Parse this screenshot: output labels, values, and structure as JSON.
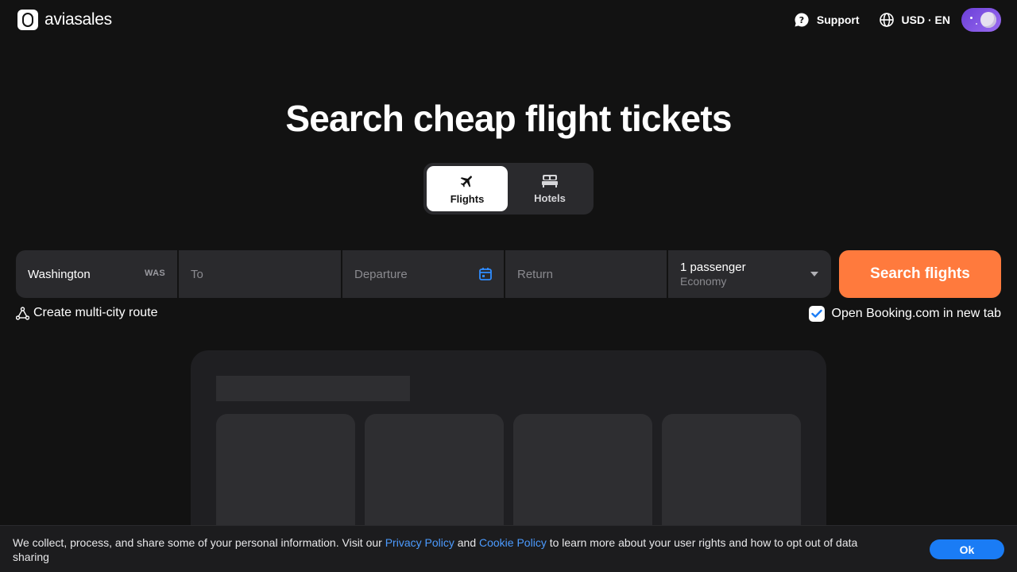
{
  "header": {
    "logo_text": "aviasales",
    "support_label": "Support",
    "currency_lang_label": "USD · EN"
  },
  "hero": {
    "title": "Search cheap flight tickets"
  },
  "tabs": [
    {
      "label": "Flights",
      "icon": "plane-icon",
      "active": true
    },
    {
      "label": "Hotels",
      "icon": "bed-icon",
      "active": false
    }
  ],
  "search": {
    "origin_value": "Washington",
    "origin_code": "WAS",
    "destination_placeholder": "To",
    "departure_placeholder": "Departure",
    "return_placeholder": "Return",
    "passengers": "1 passenger",
    "cabin_class": "Economy",
    "button_label": "Search flights"
  },
  "options": {
    "multi_city_label": "Create multi-city route",
    "booking_label": "Open Booking.com in new tab",
    "booking_checked": true
  },
  "cookie": {
    "text_before": "We collect, process, and share some of your personal information. Visit our ",
    "privacy_link": "Privacy Policy",
    "text_middle": " and ",
    "cookie_link": "Cookie Policy",
    "text_after": " to learn more about your user rights and how to opt out of data sharing",
    "ok_label": "Ok"
  },
  "colors": {
    "background": "#121212",
    "field": "#2a2a2d",
    "accent_orange": "#ff7a3d",
    "link_blue": "#4c9bff",
    "ok_blue": "#1a7cf5"
  }
}
